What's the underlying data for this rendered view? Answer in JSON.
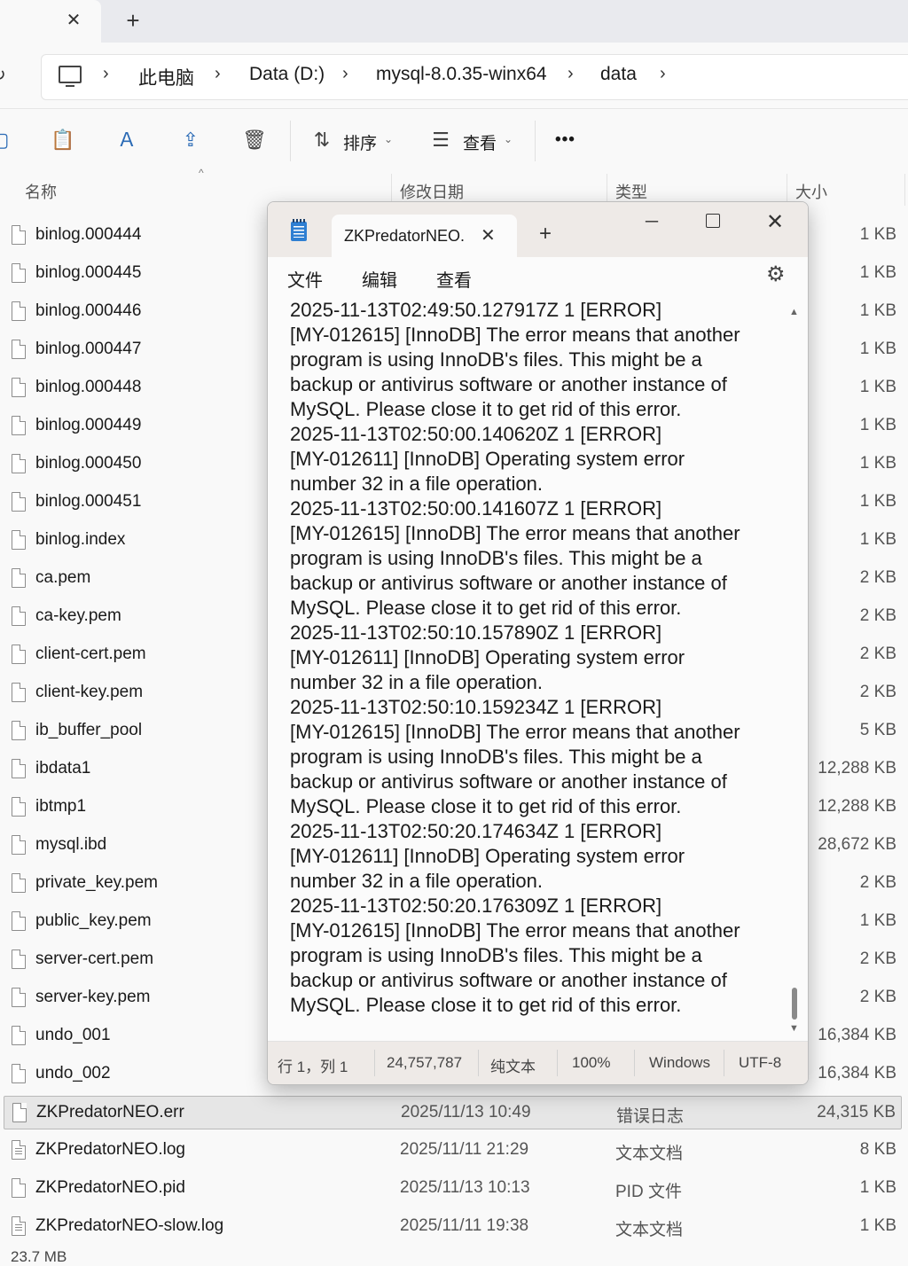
{
  "explorer": {
    "tab_close": "✕",
    "tab_new": "+",
    "breadcrumbs": [
      "此电脑",
      "Data (D:)",
      "mysql-8.0.35-winx64",
      "data"
    ],
    "toolbar": {
      "sort_label": "排序",
      "view_label": "查看",
      "more_label": "•••"
    },
    "columns": {
      "name": "名称",
      "modified": "修改日期",
      "type": "类型",
      "size": "大小"
    },
    "files": [
      {
        "name": "binlog.000444",
        "date": "",
        "type": "",
        "size": "1 KB",
        "icon": "file"
      },
      {
        "name": "binlog.000445",
        "date": "",
        "type": "",
        "size": "1 KB",
        "icon": "file"
      },
      {
        "name": "binlog.000446",
        "date": "",
        "type": "",
        "size": "1 KB",
        "icon": "file"
      },
      {
        "name": "binlog.000447",
        "date": "",
        "type": "",
        "size": "1 KB",
        "icon": "file"
      },
      {
        "name": "binlog.000448",
        "date": "",
        "type": "",
        "size": "1 KB",
        "icon": "file"
      },
      {
        "name": "binlog.000449",
        "date": "",
        "type": "",
        "size": "1 KB",
        "icon": "file"
      },
      {
        "name": "binlog.000450",
        "date": "",
        "type": "",
        "size": "1 KB",
        "icon": "file"
      },
      {
        "name": "binlog.000451",
        "date": "",
        "type": "",
        "size": "1 KB",
        "icon": "file"
      },
      {
        "name": "binlog.index",
        "date": "",
        "type": "",
        "size": "1 KB",
        "icon": "file"
      },
      {
        "name": "ca.pem",
        "date": "",
        "type": "",
        "size": "2 KB",
        "icon": "file"
      },
      {
        "name": "ca-key.pem",
        "date": "",
        "type": "",
        "size": "2 KB",
        "icon": "file"
      },
      {
        "name": "client-cert.pem",
        "date": "",
        "type": "",
        "size": "2 KB",
        "icon": "file"
      },
      {
        "name": "client-key.pem",
        "date": "",
        "type": "",
        "size": "2 KB",
        "icon": "file"
      },
      {
        "name": "ib_buffer_pool",
        "date": "",
        "type": "",
        "size": "5 KB",
        "icon": "file"
      },
      {
        "name": "ibdata1",
        "date": "",
        "type": "",
        "size": "12,288 KB",
        "icon": "file"
      },
      {
        "name": "ibtmp1",
        "date": "",
        "type": "",
        "size": "12,288 KB",
        "icon": "file"
      },
      {
        "name": "mysql.ibd",
        "date": "",
        "type": "",
        "size": "28,672 KB",
        "icon": "file"
      },
      {
        "name": "private_key.pem",
        "date": "",
        "type": "",
        "size": "2 KB",
        "icon": "file"
      },
      {
        "name": "public_key.pem",
        "date": "",
        "type": "",
        "size": "1 KB",
        "icon": "file"
      },
      {
        "name": "server-cert.pem",
        "date": "",
        "type": "",
        "size": "2 KB",
        "icon": "file"
      },
      {
        "name": "server-key.pem",
        "date": "",
        "type": "",
        "size": "2 KB",
        "icon": "file"
      },
      {
        "name": "undo_001",
        "date": "",
        "type": "",
        "size": "16,384 KB",
        "icon": "file"
      },
      {
        "name": "undo_002",
        "date": "",
        "type": "",
        "size": "16,384 KB",
        "icon": "file"
      },
      {
        "name": "ZKPredatorNEO.err",
        "date": "2025/11/13 10:49",
        "type": "错误日志",
        "size": "24,315 KB",
        "icon": "file",
        "selected": true
      },
      {
        "name": "ZKPredatorNEO.log",
        "date": "2025/11/11 21:29",
        "type": "文本文档",
        "size": "8 KB",
        "icon": "doc"
      },
      {
        "name": "ZKPredatorNEO.pid",
        "date": "2025/11/13 10:13",
        "type": "PID 文件",
        "size": "1 KB",
        "icon": "file"
      },
      {
        "name": "ZKPredatorNEO-slow.log",
        "date": "2025/11/11 19:38",
        "type": "文本文档",
        "size": "1 KB",
        "icon": "doc"
      }
    ],
    "status_text": "23.7 MB"
  },
  "notepad": {
    "tab_title": "ZKPredatorNEO.err",
    "menus": [
      "文件",
      "编辑",
      "查看"
    ],
    "content": "2025-11-13T02:49:50.127917Z 1 [ERROR]\n[MY-012615] [InnoDB] The error means that another\nprogram is using InnoDB's files. This might be a\nbackup or antivirus software or another instance of\nMySQL. Please close it to get rid of this error.\n2025-11-13T02:50:00.140620Z 1 [ERROR]\n[MY-012611] [InnoDB] Operating system error\nnumber 32 in a file operation.\n2025-11-13T02:50:00.141607Z 1 [ERROR]\n[MY-012615] [InnoDB] The error means that another\nprogram is using InnoDB's files. This might be a\nbackup or antivirus software or another instance of\nMySQL. Please close it to get rid of this error.\n2025-11-13T02:50:10.157890Z 1 [ERROR]\n[MY-012611] [InnoDB] Operating system error\nnumber 32 in a file operation.\n2025-11-13T02:50:10.159234Z 1 [ERROR]\n[MY-012615] [InnoDB] The error means that another\nprogram is using InnoDB's files. This might be a\nbackup or antivirus software or another instance of\nMySQL. Please close it to get rid of this error.\n2025-11-13T02:50:20.174634Z 1 [ERROR]\n[MY-012611] [InnoDB] Operating system error\nnumber 32 in a file operation.\n2025-11-13T02:50:20.176309Z 1 [ERROR]\n[MY-012615] [InnoDB] The error means that another\nprogram is using InnoDB's files. This might be a\nbackup or antivirus software or another instance of\nMySQL. Please close it to get rid of this error.",
    "status": {
      "position": "行 1，列 1",
      "chars": "24,757,787",
      "format": "纯文本",
      "zoom": "100%",
      "line_ending": "Windows (CRLF)",
      "encoding": "UTF-8"
    }
  }
}
